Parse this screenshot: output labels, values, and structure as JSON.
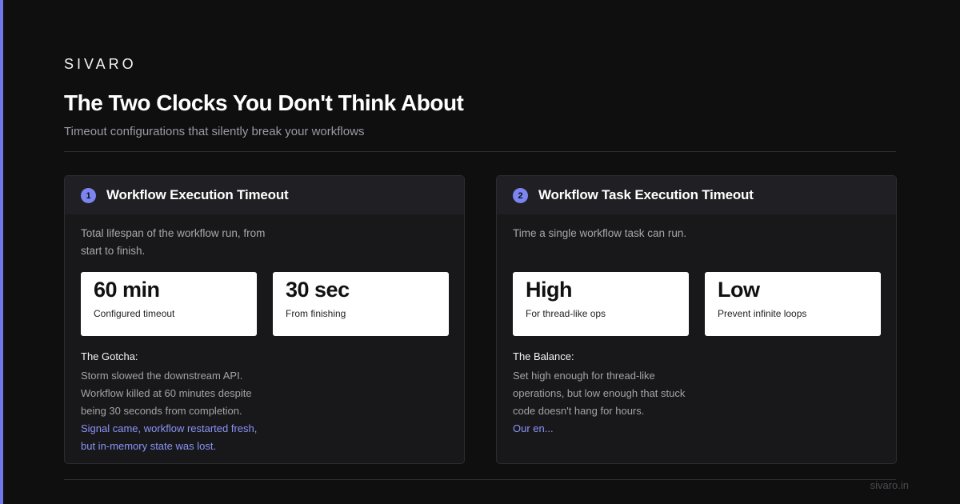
{
  "brand": "SIVARO",
  "title": "The Two Clocks You Don't Think About",
  "subtitle": "Timeout configurations that silently break your workflows",
  "footer_url": "sivaro.in",
  "colors": {
    "accent": "#7b84f0",
    "background": "#0f0f10",
    "card": "#18181b",
    "link": "#8a93f5"
  },
  "cards": [
    {
      "number": "1",
      "title": "Workflow Execution Timeout",
      "description": "Total lifespan of the workflow run, from start to finish.",
      "stats": [
        {
          "value": "60 min",
          "label": "Configured timeout"
        },
        {
          "value": "30 sec",
          "label": "From finishing"
        }
      ],
      "note_heading": "The Gotcha:",
      "note_text": "Storm slowed the downstream API. Workflow killed at 60 minutes despite being 30 seconds from completion.",
      "note_highlight": "Signal came, workflow restarted fresh, but in-memory state was lost."
    },
    {
      "number": "2",
      "title": "Workflow Task Execution Timeout",
      "description": "Time a single workflow task can run.",
      "stats": [
        {
          "value": "High",
          "label": "For thread-like ops"
        },
        {
          "value": "Low",
          "label": "Prevent infinite loops"
        }
      ],
      "note_heading": "The Balance:",
      "note_text": "Set high enough for thread-like operations, but low enough that stuck code doesn't hang for hours.",
      "note_highlight": "Our en..."
    }
  ]
}
